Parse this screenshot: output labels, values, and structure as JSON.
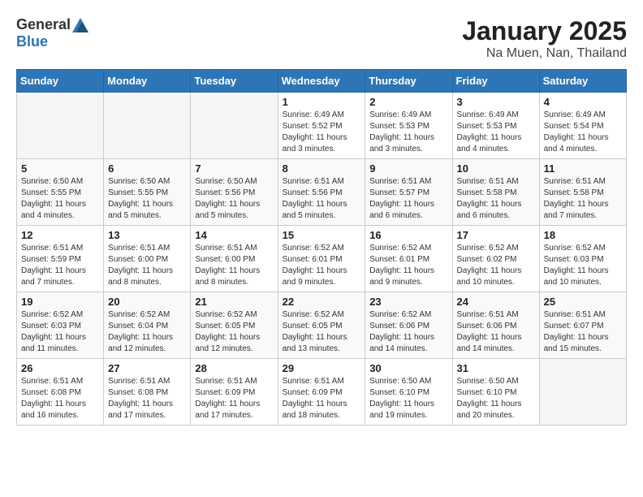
{
  "header": {
    "logo_general": "General",
    "logo_blue": "Blue",
    "title": "January 2025",
    "subtitle": "Na Muen, Nan, Thailand"
  },
  "weekdays": [
    "Sunday",
    "Monday",
    "Tuesday",
    "Wednesday",
    "Thursday",
    "Friday",
    "Saturday"
  ],
  "weeks": [
    [
      {
        "day": "",
        "info": ""
      },
      {
        "day": "",
        "info": ""
      },
      {
        "day": "",
        "info": ""
      },
      {
        "day": "1",
        "info": "Sunrise: 6:49 AM\nSunset: 5:52 PM\nDaylight: 11 hours\nand 3 minutes."
      },
      {
        "day": "2",
        "info": "Sunrise: 6:49 AM\nSunset: 5:53 PM\nDaylight: 11 hours\nand 3 minutes."
      },
      {
        "day": "3",
        "info": "Sunrise: 6:49 AM\nSunset: 5:53 PM\nDaylight: 11 hours\nand 4 minutes."
      },
      {
        "day": "4",
        "info": "Sunrise: 6:49 AM\nSunset: 5:54 PM\nDaylight: 11 hours\nand 4 minutes."
      }
    ],
    [
      {
        "day": "5",
        "info": "Sunrise: 6:50 AM\nSunset: 5:55 PM\nDaylight: 11 hours\nand 4 minutes."
      },
      {
        "day": "6",
        "info": "Sunrise: 6:50 AM\nSunset: 5:55 PM\nDaylight: 11 hours\nand 5 minutes."
      },
      {
        "day": "7",
        "info": "Sunrise: 6:50 AM\nSunset: 5:56 PM\nDaylight: 11 hours\nand 5 minutes."
      },
      {
        "day": "8",
        "info": "Sunrise: 6:51 AM\nSunset: 5:56 PM\nDaylight: 11 hours\nand 5 minutes."
      },
      {
        "day": "9",
        "info": "Sunrise: 6:51 AM\nSunset: 5:57 PM\nDaylight: 11 hours\nand 6 minutes."
      },
      {
        "day": "10",
        "info": "Sunrise: 6:51 AM\nSunset: 5:58 PM\nDaylight: 11 hours\nand 6 minutes."
      },
      {
        "day": "11",
        "info": "Sunrise: 6:51 AM\nSunset: 5:58 PM\nDaylight: 11 hours\nand 7 minutes."
      }
    ],
    [
      {
        "day": "12",
        "info": "Sunrise: 6:51 AM\nSunset: 5:59 PM\nDaylight: 11 hours\nand 7 minutes."
      },
      {
        "day": "13",
        "info": "Sunrise: 6:51 AM\nSunset: 6:00 PM\nDaylight: 11 hours\nand 8 minutes."
      },
      {
        "day": "14",
        "info": "Sunrise: 6:51 AM\nSunset: 6:00 PM\nDaylight: 11 hours\nand 8 minutes."
      },
      {
        "day": "15",
        "info": "Sunrise: 6:52 AM\nSunset: 6:01 PM\nDaylight: 11 hours\nand 9 minutes."
      },
      {
        "day": "16",
        "info": "Sunrise: 6:52 AM\nSunset: 6:01 PM\nDaylight: 11 hours\nand 9 minutes."
      },
      {
        "day": "17",
        "info": "Sunrise: 6:52 AM\nSunset: 6:02 PM\nDaylight: 11 hours\nand 10 minutes."
      },
      {
        "day": "18",
        "info": "Sunrise: 6:52 AM\nSunset: 6:03 PM\nDaylight: 11 hours\nand 10 minutes."
      }
    ],
    [
      {
        "day": "19",
        "info": "Sunrise: 6:52 AM\nSunset: 6:03 PM\nDaylight: 11 hours\nand 11 minutes."
      },
      {
        "day": "20",
        "info": "Sunrise: 6:52 AM\nSunset: 6:04 PM\nDaylight: 11 hours\nand 12 minutes."
      },
      {
        "day": "21",
        "info": "Sunrise: 6:52 AM\nSunset: 6:05 PM\nDaylight: 11 hours\nand 12 minutes."
      },
      {
        "day": "22",
        "info": "Sunrise: 6:52 AM\nSunset: 6:05 PM\nDaylight: 11 hours\nand 13 minutes."
      },
      {
        "day": "23",
        "info": "Sunrise: 6:52 AM\nSunset: 6:06 PM\nDaylight: 11 hours\nand 14 minutes."
      },
      {
        "day": "24",
        "info": "Sunrise: 6:51 AM\nSunset: 6:06 PM\nDaylight: 11 hours\nand 14 minutes."
      },
      {
        "day": "25",
        "info": "Sunrise: 6:51 AM\nSunset: 6:07 PM\nDaylight: 11 hours\nand 15 minutes."
      }
    ],
    [
      {
        "day": "26",
        "info": "Sunrise: 6:51 AM\nSunset: 6:08 PM\nDaylight: 11 hours\nand 16 minutes."
      },
      {
        "day": "27",
        "info": "Sunrise: 6:51 AM\nSunset: 6:08 PM\nDaylight: 11 hours\nand 17 minutes."
      },
      {
        "day": "28",
        "info": "Sunrise: 6:51 AM\nSunset: 6:09 PM\nDaylight: 11 hours\nand 17 minutes."
      },
      {
        "day": "29",
        "info": "Sunrise: 6:51 AM\nSunset: 6:09 PM\nDaylight: 11 hours\nand 18 minutes."
      },
      {
        "day": "30",
        "info": "Sunrise: 6:50 AM\nSunset: 6:10 PM\nDaylight: 11 hours\nand 19 minutes."
      },
      {
        "day": "31",
        "info": "Sunrise: 6:50 AM\nSunset: 6:10 PM\nDaylight: 11 hours\nand 20 minutes."
      },
      {
        "day": "",
        "info": ""
      }
    ]
  ]
}
